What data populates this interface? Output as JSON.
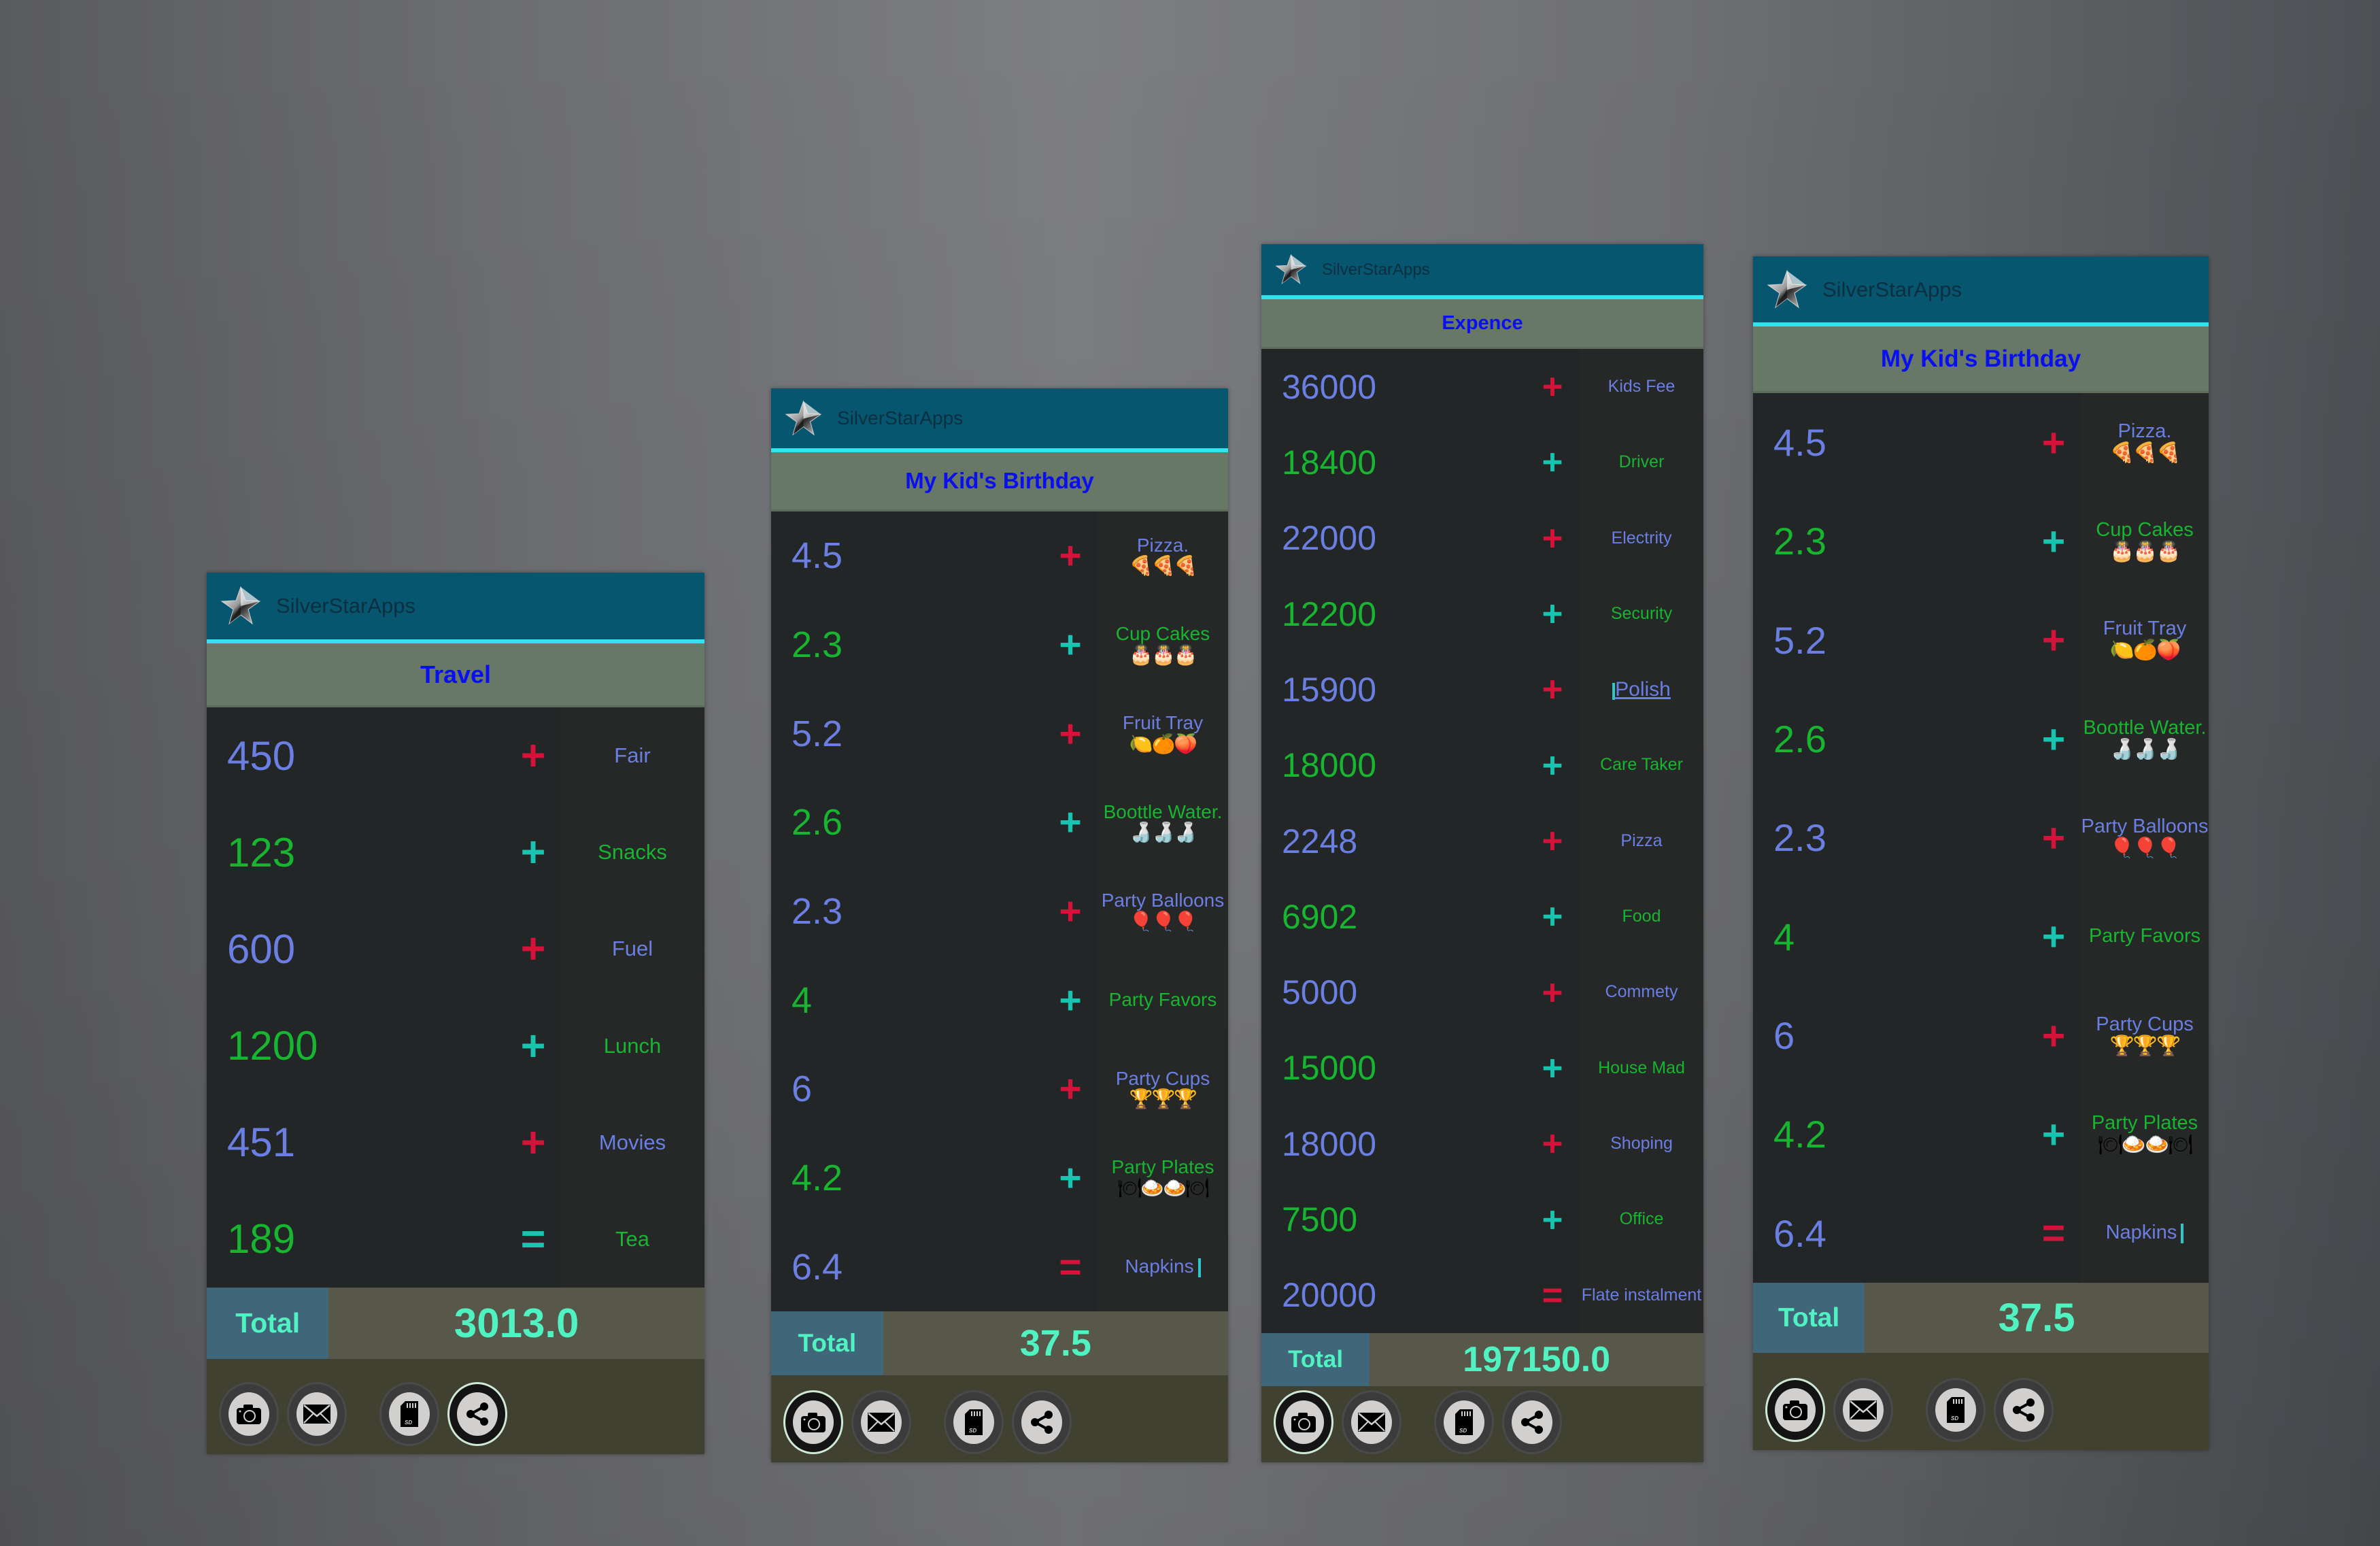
{
  "app_name": "SilverStarApps",
  "total_label": "Total",
  "footer_buttons": [
    {
      "name": "camera",
      "icon": "camera-icon"
    },
    {
      "name": "email",
      "icon": "envelope-icon"
    },
    {
      "name": "sd-card",
      "icon": "sd-card-icon"
    },
    {
      "name": "share",
      "icon": "share-icon"
    }
  ],
  "colors": {
    "appbar": "#06566f",
    "appbar_accent": "#2fe3ef",
    "title_band": "#687866",
    "title_text": "#0a0ff0",
    "row_bg": "#232627",
    "blue_text": "#6b7fe3",
    "green_text": "#17b530",
    "op_red": "#d4123a",
    "op_teal": "#17c4b0",
    "total_text": "#50f2c2"
  },
  "screens": [
    {
      "title": "Travel",
      "total": "3013.0",
      "active_button": "share",
      "rows": [
        {
          "amount": "450",
          "op": "+",
          "label": "Fair",
          "emoji": ""
        },
        {
          "amount": "123",
          "op": "+",
          "label": "Snacks",
          "emoji": ""
        },
        {
          "amount": "600",
          "op": "+",
          "label": "Fuel",
          "emoji": ""
        },
        {
          "amount": "1200",
          "op": "+",
          "label": "Lunch",
          "emoji": ""
        },
        {
          "amount": "451",
          "op": "+",
          "label": "Movies",
          "emoji": ""
        },
        {
          "amount": "189",
          "op": "=",
          "label": "Tea",
          "emoji": ""
        }
      ]
    },
    {
      "title": "My Kid's Birthday",
      "total": "37.5",
      "active_button": "camera",
      "rows": [
        {
          "amount": "4.5",
          "op": "+",
          "label": "Pizza.",
          "emoji": "🍕🍕🍕"
        },
        {
          "amount": "2.3",
          "op": "+",
          "label": "Cup Cakes",
          "emoji": "🎂🎂🎂"
        },
        {
          "amount": "5.2",
          "op": "+",
          "label": "Fruit Tray",
          "emoji": "🍋🍊🍑"
        },
        {
          "amount": "2.6",
          "op": "+",
          "label": "Boottle Water.",
          "emoji": "🍶🍶🍶"
        },
        {
          "amount": "2.3",
          "op": "+",
          "label": "Party Balloons",
          "emoji": "🎈🎈🎈"
        },
        {
          "amount": "4",
          "op": "+",
          "label": "Party Favors",
          "emoji": ""
        },
        {
          "amount": "6",
          "op": "+",
          "label": "Party Cups",
          "emoji": "🏆🏆🏆"
        },
        {
          "amount": "4.2",
          "op": "+",
          "label": "Party Plates",
          "emoji": "🍽🍛🍛🍽"
        },
        {
          "amount": "6.4",
          "op": "=",
          "label": "Napkins",
          "emoji": "",
          "cursor": "after"
        }
      ]
    },
    {
      "title": "Expence",
      "total": "197150.0",
      "active_button": "camera",
      "rows": [
        {
          "amount": "36000",
          "op": "+",
          "label": "Kids Fee",
          "emoji": ""
        },
        {
          "amount": "18400",
          "op": "+",
          "label": "Driver",
          "emoji": ""
        },
        {
          "amount": "22000",
          "op": "+",
          "label": "Electrity",
          "emoji": ""
        },
        {
          "amount": "12200",
          "op": "+",
          "label": "Security",
          "emoji": ""
        },
        {
          "amount": "15900",
          "op": "+",
          "label": "Polish",
          "emoji": "",
          "cursor": "before"
        },
        {
          "amount": "18000",
          "op": "+",
          "label": "Care Taker",
          "emoji": ""
        },
        {
          "amount": "2248",
          "op": "+",
          "label": "Pizza",
          "emoji": ""
        },
        {
          "amount": "6902",
          "op": "+",
          "label": "Food",
          "emoji": ""
        },
        {
          "amount": "5000",
          "op": "+",
          "label": "Commety",
          "emoji": ""
        },
        {
          "amount": "15000",
          "op": "+",
          "label": "House Mad",
          "emoji": ""
        },
        {
          "amount": "18000",
          "op": "+",
          "label": "Shoping",
          "emoji": ""
        },
        {
          "amount": "7500",
          "op": "+",
          "label": "Office",
          "emoji": ""
        },
        {
          "amount": "20000",
          "op": "=",
          "label": "Flate instalment",
          "emoji": ""
        }
      ]
    },
    {
      "title": "My Kid's Birthday",
      "total": "37.5",
      "active_button": "camera",
      "rows": [
        {
          "amount": "4.5",
          "op": "+",
          "label": "Pizza.",
          "emoji": "🍕🍕🍕"
        },
        {
          "amount": "2.3",
          "op": "+",
          "label": "Cup Cakes",
          "emoji": "🎂🎂🎂"
        },
        {
          "amount": "5.2",
          "op": "+",
          "label": "Fruit Tray",
          "emoji": "🍋🍊🍑"
        },
        {
          "amount": "2.6",
          "op": "+",
          "label": "Boottle Water.",
          "emoji": "🍶🍶🍶"
        },
        {
          "amount": "2.3",
          "op": "+",
          "label": "Party Balloons",
          "emoji": "🎈🎈🎈"
        },
        {
          "amount": "4",
          "op": "+",
          "label": "Party Favors",
          "emoji": ""
        },
        {
          "amount": "6",
          "op": "+",
          "label": "Party Cups",
          "emoji": "🏆🏆🏆"
        },
        {
          "amount": "4.2",
          "op": "+",
          "label": "Party Plates",
          "emoji": "🍽🍛🍛🍽"
        },
        {
          "amount": "6.4",
          "op": "=",
          "label": "Napkins",
          "emoji": "",
          "cursor": "after"
        }
      ]
    }
  ]
}
